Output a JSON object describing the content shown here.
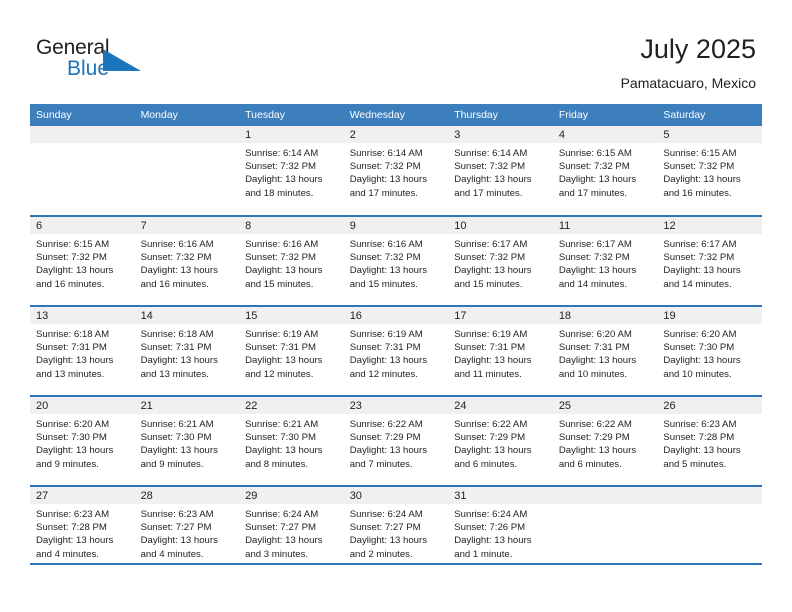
{
  "brand": {
    "name_part1": "General",
    "name_part2": "Blue",
    "logo_icon": "blue-triangle-flag-icon",
    "color_dark": "#231f20",
    "color_blue": "#1b75bb"
  },
  "header": {
    "title": "July 2025",
    "subtitle": "Pamatacuaro, Mexico"
  },
  "theme": {
    "header_blue": "#3d7ebd",
    "rule_blue": "#2e76b8",
    "daynum_background": "#f0f0f0",
    "text": "#231f20"
  },
  "weekday_headers": [
    "Sunday",
    "Monday",
    "Tuesday",
    "Wednesday",
    "Thursday",
    "Friday",
    "Saturday"
  ],
  "weeks": [
    [
      {
        "day": "",
        "lines": []
      },
      {
        "day": "",
        "lines": []
      },
      {
        "day": "1",
        "lines": [
          "Sunrise: 6:14 AM",
          "Sunset: 7:32 PM",
          "Daylight: 13 hours",
          "and 18 minutes."
        ]
      },
      {
        "day": "2",
        "lines": [
          "Sunrise: 6:14 AM",
          "Sunset: 7:32 PM",
          "Daylight: 13 hours",
          "and 17 minutes."
        ]
      },
      {
        "day": "3",
        "lines": [
          "Sunrise: 6:14 AM",
          "Sunset: 7:32 PM",
          "Daylight: 13 hours",
          "and 17 minutes."
        ]
      },
      {
        "day": "4",
        "lines": [
          "Sunrise: 6:15 AM",
          "Sunset: 7:32 PM",
          "Daylight: 13 hours",
          "and 17 minutes."
        ]
      },
      {
        "day": "5",
        "lines": [
          "Sunrise: 6:15 AM",
          "Sunset: 7:32 PM",
          "Daylight: 13 hours",
          "and 16 minutes."
        ]
      }
    ],
    [
      {
        "day": "6",
        "lines": [
          "Sunrise: 6:15 AM",
          "Sunset: 7:32 PM",
          "Daylight: 13 hours",
          "and 16 minutes."
        ]
      },
      {
        "day": "7",
        "lines": [
          "Sunrise: 6:16 AM",
          "Sunset: 7:32 PM",
          "Daylight: 13 hours",
          "and 16 minutes."
        ]
      },
      {
        "day": "8",
        "lines": [
          "Sunrise: 6:16 AM",
          "Sunset: 7:32 PM",
          "Daylight: 13 hours",
          "and 15 minutes."
        ]
      },
      {
        "day": "9",
        "lines": [
          "Sunrise: 6:16 AM",
          "Sunset: 7:32 PM",
          "Daylight: 13 hours",
          "and 15 minutes."
        ]
      },
      {
        "day": "10",
        "lines": [
          "Sunrise: 6:17 AM",
          "Sunset: 7:32 PM",
          "Daylight: 13 hours",
          "and 15 minutes."
        ]
      },
      {
        "day": "11",
        "lines": [
          "Sunrise: 6:17 AM",
          "Sunset: 7:32 PM",
          "Daylight: 13 hours",
          "and 14 minutes."
        ]
      },
      {
        "day": "12",
        "lines": [
          "Sunrise: 6:17 AM",
          "Sunset: 7:32 PM",
          "Daylight: 13 hours",
          "and 14 minutes."
        ]
      }
    ],
    [
      {
        "day": "13",
        "lines": [
          "Sunrise: 6:18 AM",
          "Sunset: 7:31 PM",
          "Daylight: 13 hours",
          "and 13 minutes."
        ]
      },
      {
        "day": "14",
        "lines": [
          "Sunrise: 6:18 AM",
          "Sunset: 7:31 PM",
          "Daylight: 13 hours",
          "and 13 minutes."
        ]
      },
      {
        "day": "15",
        "lines": [
          "Sunrise: 6:19 AM",
          "Sunset: 7:31 PM",
          "Daylight: 13 hours",
          "and 12 minutes."
        ]
      },
      {
        "day": "16",
        "lines": [
          "Sunrise: 6:19 AM",
          "Sunset: 7:31 PM",
          "Daylight: 13 hours",
          "and 12 minutes."
        ]
      },
      {
        "day": "17",
        "lines": [
          "Sunrise: 6:19 AM",
          "Sunset: 7:31 PM",
          "Daylight: 13 hours",
          "and 11 minutes."
        ]
      },
      {
        "day": "18",
        "lines": [
          "Sunrise: 6:20 AM",
          "Sunset: 7:31 PM",
          "Daylight: 13 hours",
          "and 10 minutes."
        ]
      },
      {
        "day": "19",
        "lines": [
          "Sunrise: 6:20 AM",
          "Sunset: 7:30 PM",
          "Daylight: 13 hours",
          "and 10 minutes."
        ]
      }
    ],
    [
      {
        "day": "20",
        "lines": [
          "Sunrise: 6:20 AM",
          "Sunset: 7:30 PM",
          "Daylight: 13 hours",
          "and 9 minutes."
        ]
      },
      {
        "day": "21",
        "lines": [
          "Sunrise: 6:21 AM",
          "Sunset: 7:30 PM",
          "Daylight: 13 hours",
          "and 9 minutes."
        ]
      },
      {
        "day": "22",
        "lines": [
          "Sunrise: 6:21 AM",
          "Sunset: 7:30 PM",
          "Daylight: 13 hours",
          "and 8 minutes."
        ]
      },
      {
        "day": "23",
        "lines": [
          "Sunrise: 6:22 AM",
          "Sunset: 7:29 PM",
          "Daylight: 13 hours",
          "and 7 minutes."
        ]
      },
      {
        "day": "24",
        "lines": [
          "Sunrise: 6:22 AM",
          "Sunset: 7:29 PM",
          "Daylight: 13 hours",
          "and 6 minutes."
        ]
      },
      {
        "day": "25",
        "lines": [
          "Sunrise: 6:22 AM",
          "Sunset: 7:29 PM",
          "Daylight: 13 hours",
          "and 6 minutes."
        ]
      },
      {
        "day": "26",
        "lines": [
          "Sunrise: 6:23 AM",
          "Sunset: 7:28 PM",
          "Daylight: 13 hours",
          "and 5 minutes."
        ]
      }
    ],
    [
      {
        "day": "27",
        "lines": [
          "Sunrise: 6:23 AM",
          "Sunset: 7:28 PM",
          "Daylight: 13 hours",
          "and 4 minutes."
        ]
      },
      {
        "day": "28",
        "lines": [
          "Sunrise: 6:23 AM",
          "Sunset: 7:27 PM",
          "Daylight: 13 hours",
          "and 4 minutes."
        ]
      },
      {
        "day": "29",
        "lines": [
          "Sunrise: 6:24 AM",
          "Sunset: 7:27 PM",
          "Daylight: 13 hours",
          "and 3 minutes."
        ]
      },
      {
        "day": "30",
        "lines": [
          "Sunrise: 6:24 AM",
          "Sunset: 7:27 PM",
          "Daylight: 13 hours",
          "and 2 minutes."
        ]
      },
      {
        "day": "31",
        "lines": [
          "Sunrise: 6:24 AM",
          "Sunset: 7:26 PM",
          "Daylight: 13 hours",
          "and 1 minute."
        ]
      },
      {
        "day": "",
        "lines": []
      },
      {
        "day": "",
        "lines": []
      }
    ]
  ]
}
